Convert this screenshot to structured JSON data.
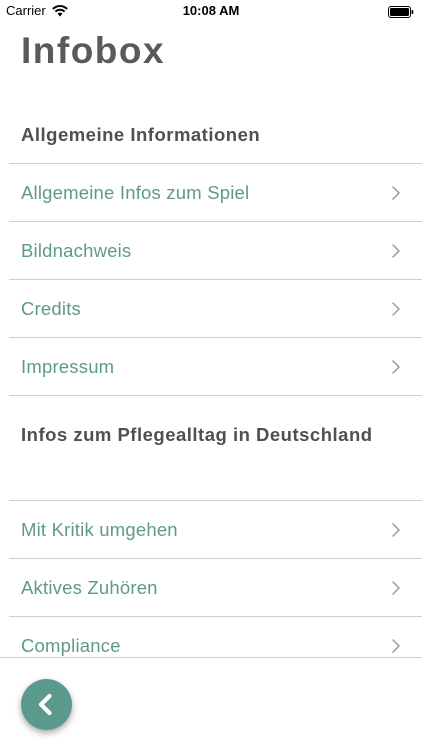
{
  "status_bar": {
    "carrier": "Carrier",
    "time": "10:08 AM",
    "wifi_icon": "wifi-icon",
    "battery_icon": "battery-full-icon"
  },
  "page": {
    "title": "Infobox"
  },
  "sections": [
    {
      "header": "Allgemeine Informationen",
      "items": [
        {
          "label": "Allgemeine Infos zum Spiel",
          "icon": "chevron-right-icon"
        },
        {
          "label": "Bildnachweis",
          "icon": "chevron-right-icon"
        },
        {
          "label": "Credits",
          "icon": "chevron-right-icon"
        },
        {
          "label": "Impressum",
          "icon": "chevron-right-icon"
        }
      ]
    },
    {
      "header": "Infos zum Pflegealltag in Deutschland",
      "items": [
        {
          "label": "Mit Kritik umgehen",
          "icon": "chevron-right-icon"
        },
        {
          "label": "Aktives Zuhören",
          "icon": "chevron-right-icon"
        },
        {
          "label": "Compliance",
          "icon": "chevron-right-icon"
        }
      ]
    }
  ],
  "back_button": {
    "icon": "chevron-left-icon"
  },
  "colors": {
    "accent": "#5a9a8c",
    "item_text": "#5f998c",
    "title_text": "#5a5a5a",
    "divider": "#cfcfcf"
  }
}
